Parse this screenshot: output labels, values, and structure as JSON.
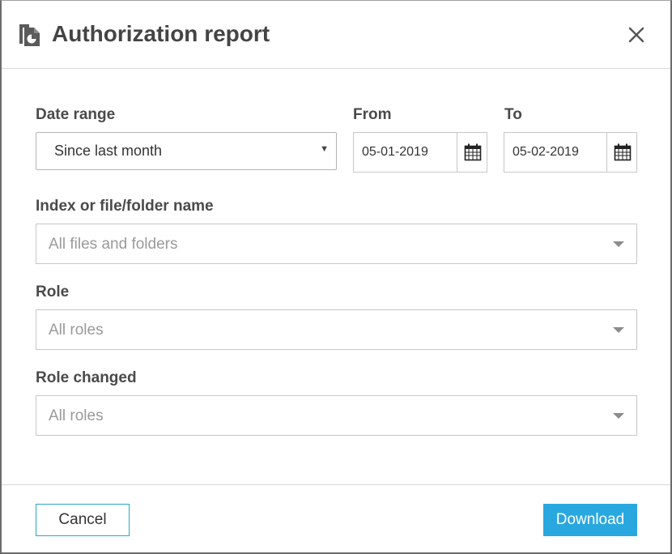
{
  "dialog": {
    "title": "Authorization report",
    "icons": {
      "title": "document-report-icon",
      "close": "close-icon",
      "calendar": "calendar-icon"
    }
  },
  "date_range": {
    "label": "Date range",
    "value": "Since last month"
  },
  "from": {
    "label": "From",
    "value": "05-01-2019"
  },
  "to": {
    "label": "To",
    "value": "05-02-2019"
  },
  "index_filter": {
    "label": "Index or file/folder name",
    "placeholder": "All files and folders"
  },
  "role": {
    "label": "Role",
    "placeholder": "All roles"
  },
  "role_changed": {
    "label": "Role changed",
    "placeholder": "All roles"
  },
  "footer": {
    "cancel_label": "Cancel",
    "download_label": "Download"
  },
  "colors": {
    "accent": "#29a8df",
    "cancel_border": "#2ca5c7",
    "title_text": "#444444",
    "placeholder_text": "#9a9a9a"
  }
}
